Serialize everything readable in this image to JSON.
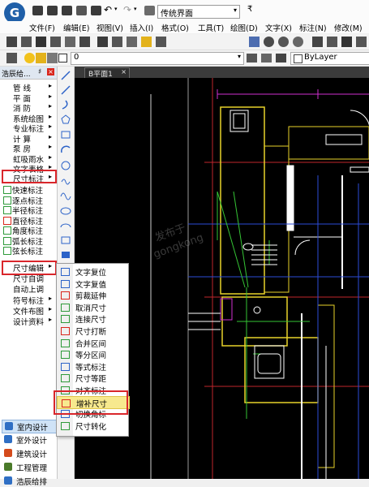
{
  "title_bar": {
    "workspace_value": "传统界面"
  },
  "menu_bar": {
    "items": [
      "文件(F)",
      "编辑(E)",
      "视图(V)",
      "插入(I)",
      "格式(O)",
      "工具(T)",
      "绘图(D)",
      "文字(X)",
      "标注(N)",
      "修改(M)"
    ]
  },
  "layer_toolbar": {
    "layer_value": "0",
    "color_value": "ByLayer"
  },
  "left_panel": {
    "title": "浩辰给...",
    "pin": "♯",
    "close": "×",
    "categories": [
      "管 线",
      "平 面",
      "消 防",
      "系统绘图",
      "专业标注",
      "计 算",
      "泵 房",
      "虹吸雨水",
      "文字表格",
      "尺寸标注"
    ],
    "tools": [
      "快速标注",
      "逐点标注",
      "半径标注",
      "直径标注",
      "角度标注",
      "弧长标注",
      "弦长标注"
    ],
    "edit_categories": [
      "尺寸编辑",
      "尺寸自调",
      "自动上调",
      "符号标注",
      "文件布图",
      "设计资料"
    ],
    "bottom_tabs": [
      "室内设计",
      "室外设计",
      "建筑设计",
      "工程管理",
      "浩辰给排"
    ]
  },
  "doc_tab": {
    "label": "B平面1",
    "close": "×"
  },
  "submenu": {
    "items": [
      "文字复位",
      "文字复值",
      "剪裁延伸",
      "取消尺寸",
      "连接尺寸",
      "尺寸打断",
      "合并区间",
      "等分区间",
      "等式标注",
      "尺寸等距",
      "对齐标注",
      "增补尺寸",
      "切换角标",
      "尺寸转化"
    ],
    "selected_index": 11
  },
  "watermark": [
    "发布于",
    "gongkong"
  ],
  "colors": {
    "highlight_border": "#d9262b",
    "selected_item": "#f7e98e",
    "canvas": "#000000"
  }
}
